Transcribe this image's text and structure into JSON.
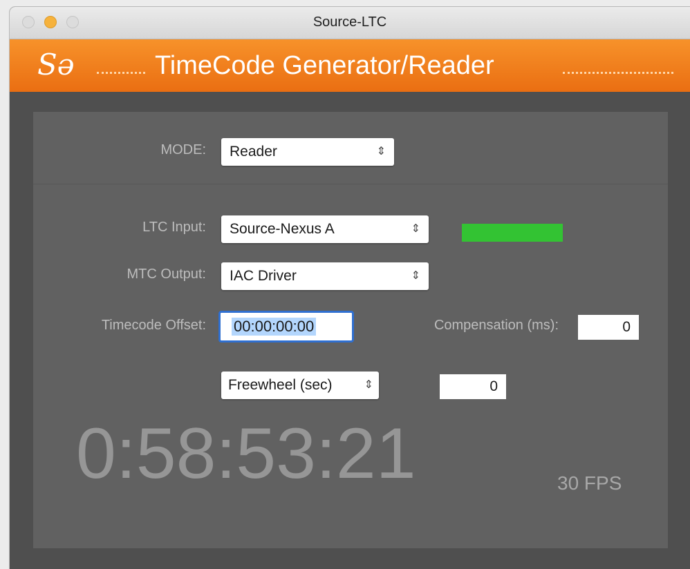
{
  "window": {
    "title": "Source-LTC"
  },
  "banner": {
    "logo": "Sə",
    "title": "TimeCode Generator/Reader"
  },
  "mode": {
    "label": "MODE:",
    "value": "Reader"
  },
  "ltc_input": {
    "label": "LTC Input:",
    "value": "Source-Nexus A",
    "signal_color": "#33c333"
  },
  "mtc_output": {
    "label": "MTC Output:",
    "value": "IAC Driver"
  },
  "timecode_offset": {
    "label": "Timecode Offset:",
    "value": "00:00:00:00"
  },
  "compensation": {
    "label": "Compensation (ms):",
    "value": "0"
  },
  "freewheel": {
    "value": "Freewheel (sec)",
    "amount": "0"
  },
  "display": {
    "timecode": "0:58:53:21",
    "fps": "30 FPS"
  },
  "colors": {
    "accent": "#f7922a",
    "background": "#4f4f4f",
    "panel": "#616161",
    "focus": "#2f6fd0"
  },
  "icons": {
    "select_arrows": "⌃⌄"
  }
}
